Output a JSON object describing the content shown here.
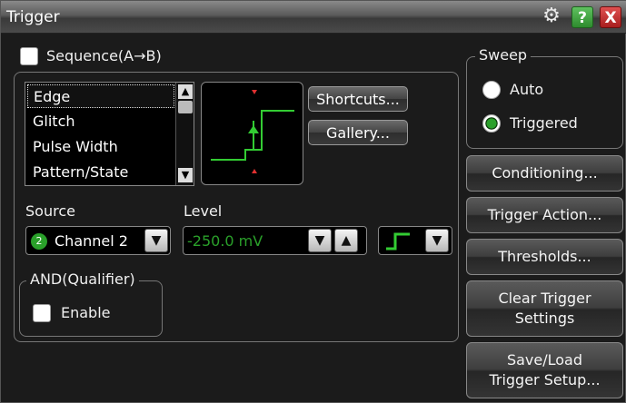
{
  "window": {
    "title": "Trigger"
  },
  "titlebar_icons": [
    "gear-icon",
    "help-icon",
    "close-icon"
  ],
  "titlebar_glyphs": {
    "help": "?",
    "close": "X",
    "gear": "⚙"
  },
  "sequence": {
    "label": "Sequence(A→B)",
    "checked": false
  },
  "trigger_types": {
    "items": [
      "Edge",
      "Glitch",
      "Pulse Width",
      "Pattern/State"
    ],
    "selected": "Edge"
  },
  "buttons": {
    "shortcuts": "Shortcuts...",
    "gallery": "Gallery..."
  },
  "source": {
    "label": "Source",
    "channel_number": "2",
    "value": "Channel 2",
    "channel_color": "#2aa02a"
  },
  "level": {
    "label": "Level",
    "value": "-250.0 mV",
    "value_color": "#2aa02a"
  },
  "qualifier": {
    "legend": "AND(Qualifier)",
    "enable_label": "Enable",
    "checked": false
  },
  "sweep": {
    "legend": "Sweep",
    "options": [
      "Auto",
      "Triggered"
    ],
    "selected": "Triggered"
  },
  "side_buttons": {
    "conditioning": "Conditioning...",
    "trigger_action": "Trigger Action...",
    "thresholds": "Thresholds...",
    "clear_line1": "Clear Trigger",
    "clear_line2": "Settings",
    "save_line1": "Save/Load",
    "save_line2": "Trigger Setup..."
  },
  "colors": {
    "accent_green": "#2aa02a",
    "waveform_green": "#33cc33",
    "marker_red": "#e03030"
  }
}
